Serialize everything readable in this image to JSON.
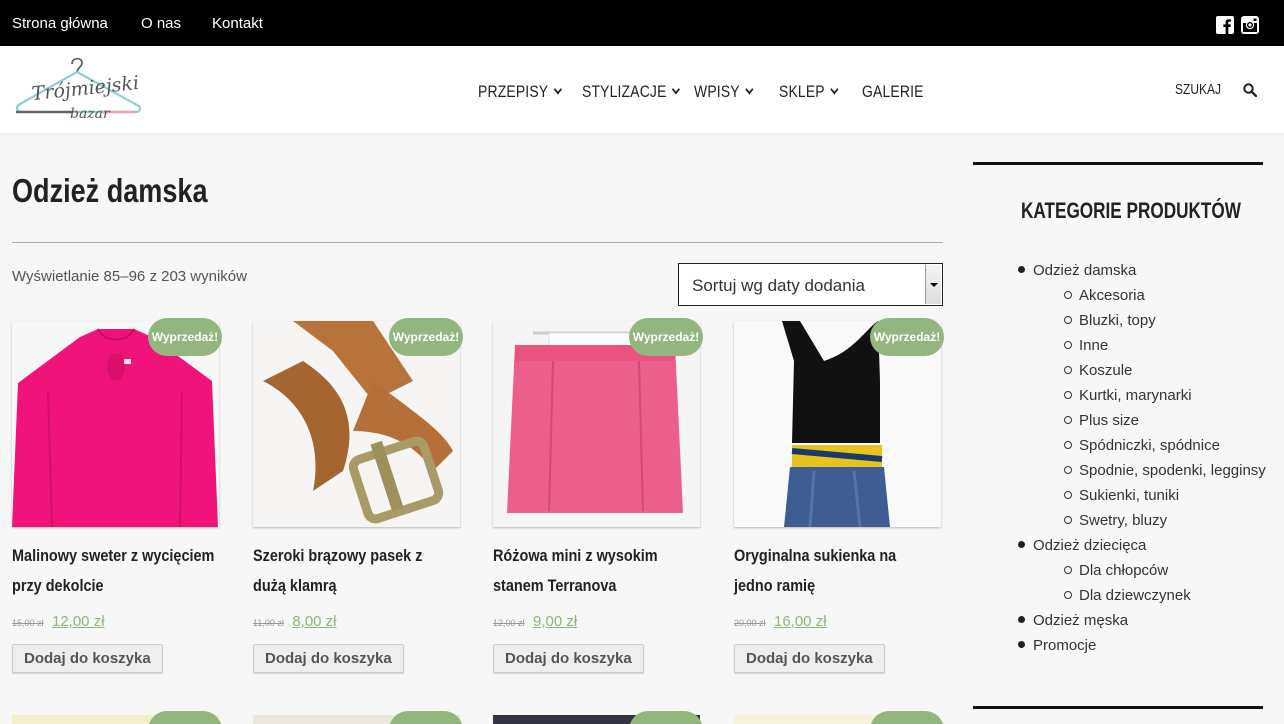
{
  "topbar": {
    "links": [
      "Strona główna",
      "O nas",
      "Kontakt"
    ]
  },
  "header": {
    "logo_text": [
      "Trójmiejski",
      "bazar"
    ],
    "nav": [
      "PRZEPISY",
      "STYLIZACJE",
      "WPISY",
      "SKLEP",
      "GALERIE"
    ],
    "search_label": "SZUKAJ"
  },
  "main": {
    "title": "Odzież damska",
    "result_count": "Wyświetlanie 85–96 z 203 wyników",
    "sort": {
      "selected": "Sortuj wg daty dodania"
    },
    "products": [
      {
        "name": "Malinowy sweter z wycięciem przy dekolcie",
        "old_price": "15,00 zł",
        "price": "12,00 zł",
        "badge": "Wyprzedaż!",
        "cart": "Dodaj do koszyka"
      },
      {
        "name": "Szeroki brązowy pasek z dużą klamrą",
        "old_price": "11,00 zł",
        "price": "8,00 zł",
        "badge": "Wyprzedaż!",
        "cart": "Dodaj do koszyka"
      },
      {
        "name": "Różowa mini z wysokim stanem Terranova",
        "old_price": "12,00 zł",
        "price": "9,00 zł",
        "badge": "Wyprzedaż!",
        "cart": "Dodaj do koszyka"
      },
      {
        "name": "Oryginalna sukienka na jedno ramię",
        "old_price": "20,00 zł",
        "price": "16,00 zł",
        "badge": "Wyprzedaż!",
        "cart": "Dodaj do koszyka"
      }
    ]
  },
  "sidebar": {
    "title": "KATEGORIE PRODUKTÓW",
    "categories": [
      {
        "label": "Odzież damska",
        "children": [
          "Akcesoria",
          "Bluzki, topy",
          "Inne",
          "Koszule",
          "Kurtki, marynarki",
          "Plus size",
          "Spódniczki, spódnice",
          "Spodnie, spodenki, legginsy",
          "Sukienki, tuniki",
          "Swetry, bluzy"
        ]
      },
      {
        "label": "Odzież dziecięca",
        "children": [
          "Dla chłopców",
          "Dla dziewczynek"
        ]
      },
      {
        "label": "Odzież męska",
        "children": []
      },
      {
        "label": "Promocje",
        "children": []
      }
    ]
  },
  "colors": {
    "sale_badge": "#93b57e",
    "price": "#8fb57b",
    "topbar": "#000000"
  }
}
